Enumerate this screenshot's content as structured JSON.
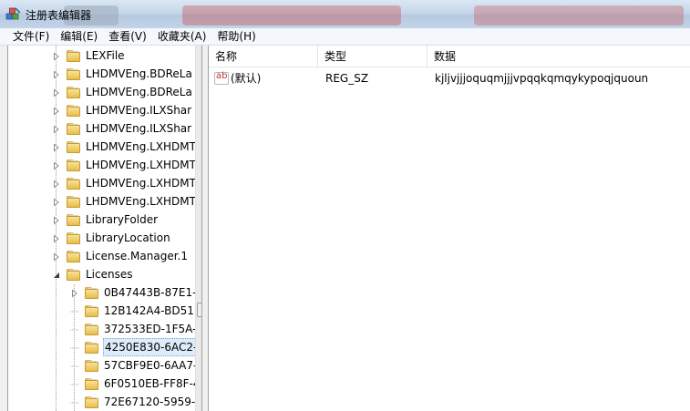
{
  "window": {
    "title": "注册表编辑器",
    "app_icon": "regedit-icon"
  },
  "menu": [
    {
      "label": "文件(F)"
    },
    {
      "label": "编辑(E)"
    },
    {
      "label": "查看(V)"
    },
    {
      "label": "收藏夹(A)"
    },
    {
      "label": "帮助(H)"
    }
  ],
  "tree": {
    "items": [
      {
        "label": "LEXFile",
        "expander": "collapsed",
        "level": 1
      },
      {
        "label": "LHDMVEng.BDReLa",
        "expander": "collapsed",
        "level": 1
      },
      {
        "label": "LHDMVEng.BDReLa",
        "expander": "collapsed",
        "level": 1
      },
      {
        "label": "LHDMVEng.ILXShar",
        "expander": "collapsed",
        "level": 1
      },
      {
        "label": "LHDMVEng.ILXShar",
        "expander": "collapsed",
        "level": 1
      },
      {
        "label": "LHDMVEng.LXHDMT",
        "expander": "collapsed",
        "level": 1
      },
      {
        "label": "LHDMVEng.LXHDMT",
        "expander": "collapsed",
        "level": 1
      },
      {
        "label": "LHDMVEng.LXHDMT",
        "expander": "collapsed",
        "level": 1
      },
      {
        "label": "LHDMVEng.LXHDMT",
        "expander": "collapsed",
        "level": 1
      },
      {
        "label": "LibraryFolder",
        "expander": "collapsed",
        "level": 1
      },
      {
        "label": "LibraryLocation",
        "expander": "collapsed",
        "level": 1
      },
      {
        "label": "License.Manager.1",
        "expander": "collapsed",
        "level": 1
      },
      {
        "label": "Licenses",
        "expander": "expanded",
        "level": 1
      },
      {
        "label": "0B47443B-87E1-",
        "expander": "collapsed",
        "level": 2
      },
      {
        "label": "12B142A4-BD51",
        "expander": "none",
        "level": 2
      },
      {
        "label": "372533ED-1F5A-",
        "expander": "none",
        "level": 2
      },
      {
        "label": "4250E830-6AC2-",
        "expander": "none",
        "level": 2,
        "selected": true
      },
      {
        "label": "57CBF9E0-6AA7-",
        "expander": "none",
        "level": 2
      },
      {
        "label": "6F0510EB-FF8F-4",
        "expander": "none",
        "level": 2
      },
      {
        "label": "72E67120-5959-",
        "expander": "none",
        "level": 2
      }
    ]
  },
  "list": {
    "columns": [
      "名称",
      "类型",
      "数据"
    ],
    "rows": [
      {
        "name": "(默认)",
        "type": "REG_SZ",
        "data": "kjljvjjjoquqmjjjvpqqkqmqykypoqjquoun",
        "icon": "string-value-icon"
      }
    ]
  }
}
